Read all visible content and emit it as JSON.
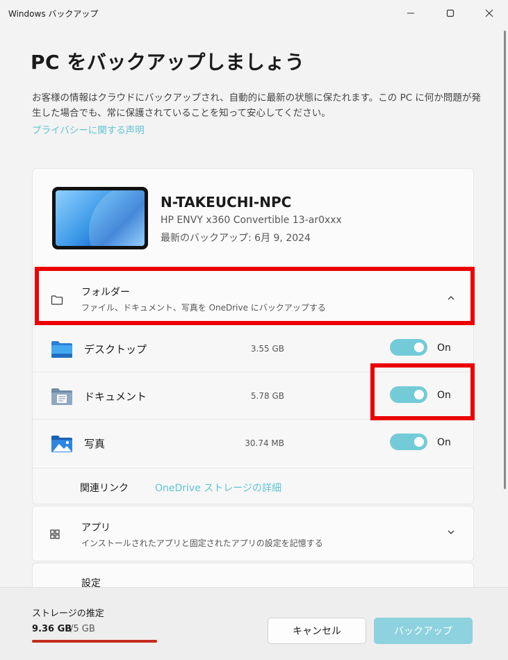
{
  "window": {
    "title": "Windows バックアップ"
  },
  "page": {
    "title": "PC をバックアップしましょう",
    "description": "お客様の情報はクラウドにバックアップされ、自動的に最新の状態に保たれます。この PC に何か問題が発生した場合でも、常に保護されていることを知って安心してください。",
    "privacy_link": "プライバシーに関する声明"
  },
  "device": {
    "name": "N-TAKEUCHI-NPC",
    "model": "HP ENVY x360 Convertible 13-ar0xxx",
    "last_backup": "最新のバックアップ: 6月 9, 2024"
  },
  "folders": {
    "title": "フォルダー",
    "subtitle": "ファイル、ドキュメント、写真を OneDrive にバックアップする",
    "items": [
      {
        "label": "デスクトップ",
        "size": "3.55 GB",
        "state": "On",
        "icon": "desktop-folder-icon"
      },
      {
        "label": "ドキュメント",
        "size": "5.78 GB",
        "state": "On",
        "icon": "documents-folder-icon"
      },
      {
        "label": "写真",
        "size": "30.74 MB",
        "state": "On",
        "icon": "pictures-folder-icon"
      }
    ],
    "related_label": "関連リンク",
    "related_link": "OneDrive ストレージの詳細"
  },
  "apps": {
    "title": "アプリ",
    "subtitle": "インストールされたアプリと固定されたアプリの設定を記憶する"
  },
  "settings": {
    "title": "設定"
  },
  "footer": {
    "storage_label": "ストレージの推定",
    "storage_used": "9.36 GB",
    "storage_total": "/5 GB",
    "storage_fraction": 1.0,
    "cancel_label": "キャンセル",
    "backup_label": "バックアップ"
  },
  "colors": {
    "accent": "#74cbd8",
    "link": "#61c3d5",
    "storage_bar": "#c42b1c",
    "highlight": "#ec0000"
  }
}
